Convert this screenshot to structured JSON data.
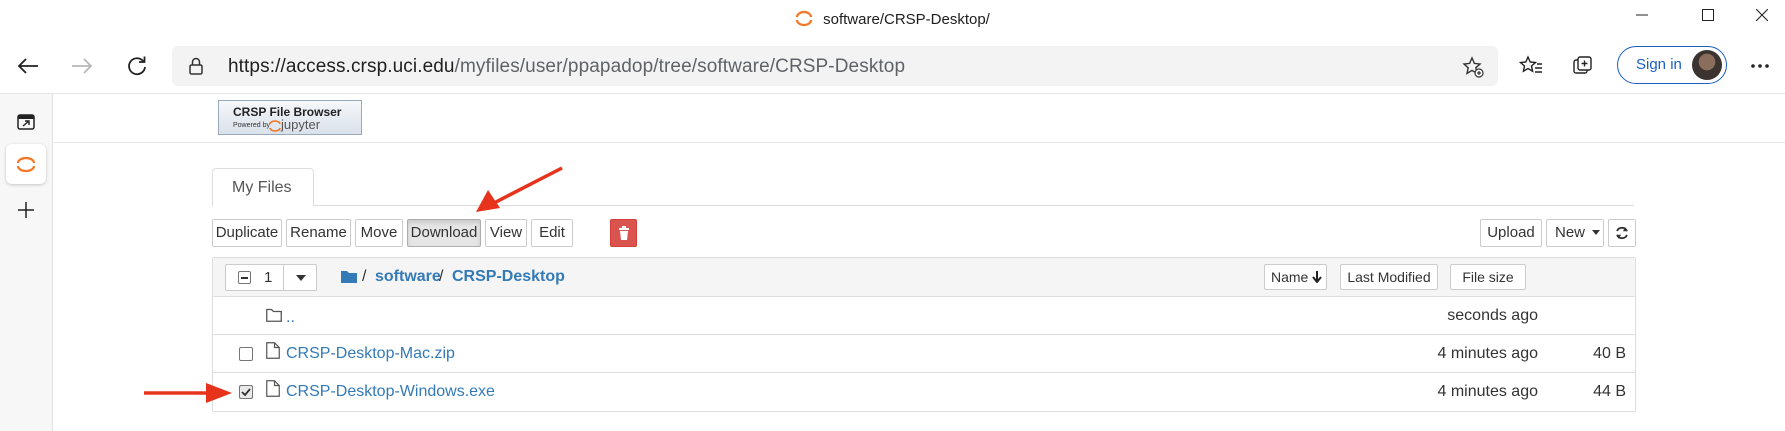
{
  "window": {
    "title": "software/CRSP-Desktop/",
    "controls": [
      "minimize",
      "maximize",
      "close"
    ]
  },
  "browser": {
    "url_host": "https://access.crsp.uci.edu",
    "url_path": "/myfiles/user/ppapadop/tree/software/CRSP-Desktop",
    "signin_label": "Sign in"
  },
  "app": {
    "logo_line1": "CRSP File Browser",
    "logo_powered": "Powered by",
    "logo_jupyter": "jupyter",
    "tab_label": "My Files"
  },
  "toolbar": {
    "duplicate": "Duplicate",
    "rename": "Rename",
    "move": "Move",
    "download": "Download",
    "view": "View",
    "edit": "Edit",
    "upload": "Upload",
    "new": "New"
  },
  "listing": {
    "selected_count": "1",
    "breadcrumb_sep": "/",
    "breadcrumb": [
      "software",
      "CRSP-Desktop"
    ],
    "sort_name": "Name",
    "sort_modified": "Last Modified",
    "sort_size": "File size",
    "rows": [
      {
        "name": "..",
        "modified": "seconds ago",
        "size": "",
        "type": "folder",
        "checked": false
      },
      {
        "name": "CRSP-Desktop-Mac.zip",
        "modified": "4 minutes ago",
        "size": "40 B",
        "type": "file",
        "checked": false
      },
      {
        "name": "CRSP-Desktop-Windows.exe",
        "modified": "4 minutes ago",
        "size": "44 B",
        "type": "file",
        "checked": true
      }
    ]
  },
  "colors": {
    "link": "#337ab7",
    "danger": "#d9534f",
    "annotation_arrow": "#e8331c",
    "edge_accent": "#1b5fc2"
  }
}
